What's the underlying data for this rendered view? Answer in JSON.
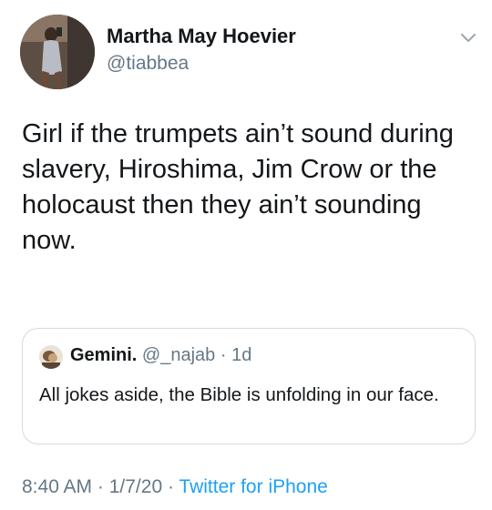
{
  "author": {
    "name": "Martha May Hoevier",
    "handle": "@tiabbea"
  },
  "tweet": {
    "text": "Girl if the trumpets ain’t sound during slavery, Hiroshima, Jim Crow or the holocaust then they ain’t sounding now."
  },
  "quoted_tweet": {
    "name": "Gemini.",
    "handle": "@_najab",
    "separator": " · ",
    "age": "1d",
    "text": "All jokes aside, the Bible is unfolding in our face."
  },
  "footer": {
    "time": "8:40 AM",
    "date": "1/7/20",
    "separator": " · ",
    "source": "Twitter for iPhone"
  },
  "icons": {
    "menu": "chevron-down-icon",
    "author_avatar": "avatar",
    "quote_avatar": "avatar"
  },
  "colors": {
    "text": "#14171a",
    "secondary": "#657786",
    "link": "#1da1f2",
    "border": "#d3dbe2"
  }
}
